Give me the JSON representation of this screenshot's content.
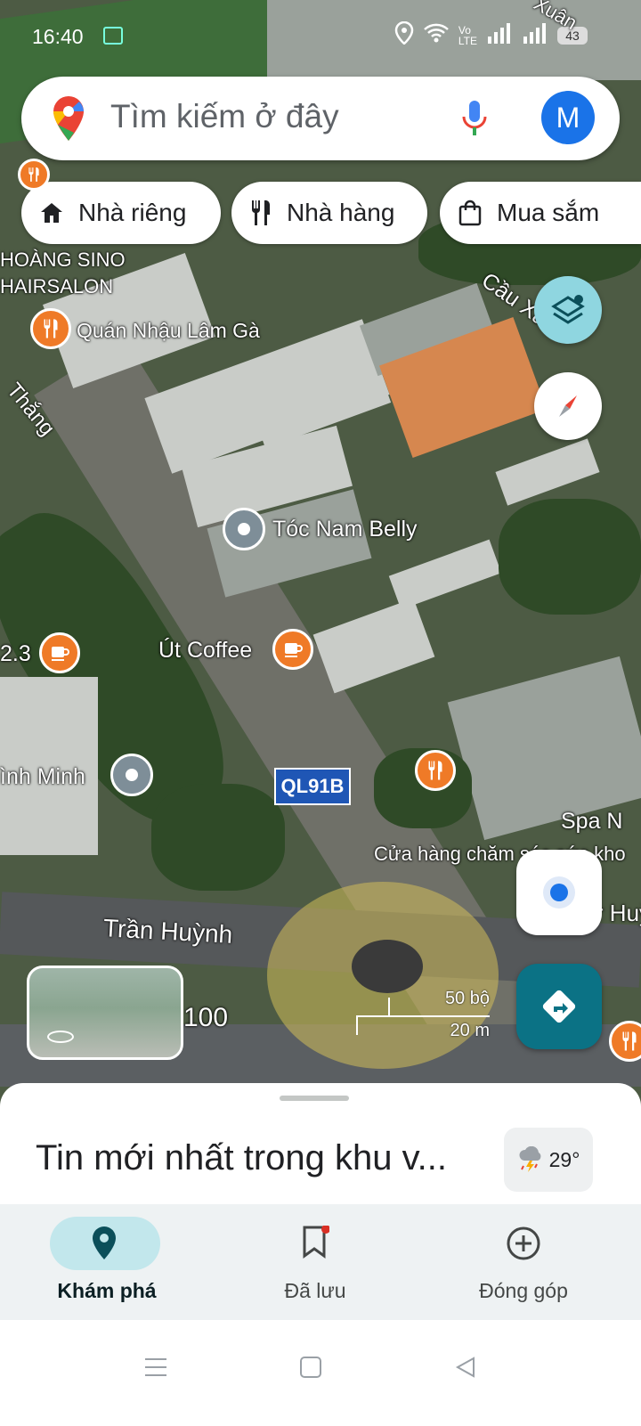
{
  "status_bar": {
    "time": "16:40",
    "battery": "43"
  },
  "search": {
    "placeholder": "Tìm kiếm ở đây",
    "avatar_letter": "M"
  },
  "chips": [
    {
      "label": "Nhà riêng",
      "icon": "home-icon"
    },
    {
      "label": "Nhà hàng",
      "icon": "restaurant-icon"
    },
    {
      "label": "Mua sắm",
      "icon": "shopping-bag-icon"
    }
  ],
  "map_labels": {
    "hoang_sino": "HOÀNG SINO",
    "hairsalon": "HAIRSALON",
    "quan_nhau": "Quán Nhậu Lâm Gà",
    "cau_xang": "Cầu Xa",
    "xuan": "Xuân",
    "thang": "Thắng",
    "toc_nam": "Tóc Nam Belly",
    "ut_coffee": "Út Coffee",
    "num_23": "2.3",
    "inh_minh": "ình Minh",
    "road_ql": "QL91B",
    "spa": "Spa N",
    "cua_hang": "Cửa hàng chăm sóc sức kho",
    "tran_huynh": "Trần Huỳnh",
    "huynh_right": "Tr Huỳ",
    "num_100": "100"
  },
  "scale": {
    "feet": "50 bộ",
    "meters": "20 m"
  },
  "sheet": {
    "title": "Tin mới nhất trong khu v...",
    "weather_temp": "29°"
  },
  "nav": [
    {
      "label": "Khám phá",
      "icon": "explore-pin-icon",
      "active": true
    },
    {
      "label": "Đã lưu",
      "icon": "bookmark-icon",
      "active": false
    },
    {
      "label": "Đóng góp",
      "icon": "add-circle-icon",
      "active": false
    }
  ],
  "colors": {
    "accent_teal": "#0b7285",
    "pin_orange": "#ef7a27",
    "blue_dot": "#1a73e8",
    "nav_active_bg": "#c2e7ec"
  }
}
